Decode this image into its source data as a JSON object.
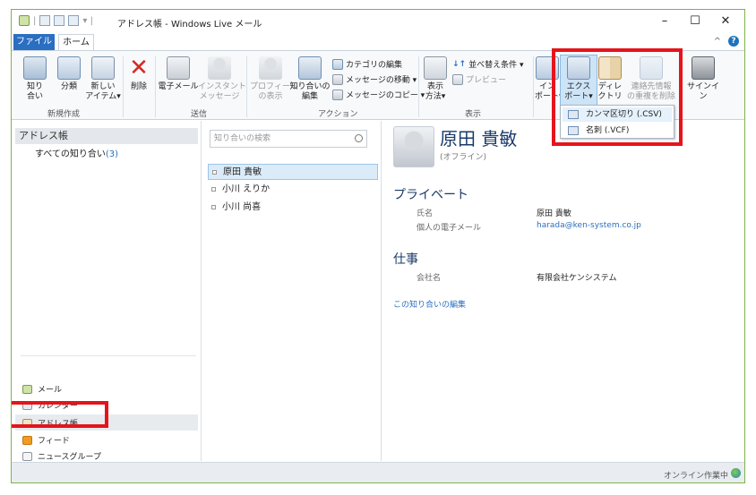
{
  "window": {
    "title": "アドレス帳 - Windows Live メール",
    "controls": {
      "minimize": "–",
      "maximize": "☐",
      "close": "✕"
    }
  },
  "tabs": {
    "file": "ファイル",
    "home": "ホーム",
    "collapse": "^",
    "help": "?"
  },
  "ribbon": {
    "new_group": {
      "label": "新規作成",
      "contact": "知り\n合い",
      "category": "分類",
      "new_item": "新しい\nアイテム▾"
    },
    "delete": "削除",
    "send_group": {
      "label": "送信",
      "email": "電子メール",
      "instant_message": "インスタント\nメッセージ"
    },
    "action_group": {
      "label": "アクション",
      "profile": "プロフィール\nの表示",
      "edit_contact": "知り合いの\n編集",
      "edit_category": "カテゴリの編集",
      "move_message": "メッセージの移動 ▾",
      "copy_message": "メッセージのコピー ▾"
    },
    "view_group": {
      "label": "表示",
      "display_method": "表示\n方法▾",
      "sort": "並べ替え条件 ▾",
      "preview": "プレビュー"
    },
    "tools": {
      "import": "イン\nポート▾",
      "export": "エクス\nポート▾",
      "directory": "ディレ\nクトリ",
      "remove_duplicates": "連絡先情報\nの重複を削除",
      "sign_in": "サインイン"
    }
  },
  "export_menu": {
    "items": [
      "カンマ区切り (.CSV)",
      "名刺 (.VCF)"
    ]
  },
  "left_pane": {
    "header": "アドレス帳",
    "all_contacts": "すべての知り合い",
    "all_contacts_count": "(3)",
    "nav": [
      "メール",
      "カレンダー",
      "アドレス帳",
      "フィード",
      "ニュースグループ"
    ]
  },
  "search": {
    "placeholder": "知り合いの検索"
  },
  "contacts": [
    "原田 貴敏",
    "小川 えりか",
    "小川 尚喜"
  ],
  "detail": {
    "name": "原田 貴敏",
    "status": "(オフライン)",
    "private_header": "プライベート",
    "name_label": "氏名",
    "name_value": "原田 貴敏",
    "email_label": "個人の電子メール",
    "email_value": "harada@ken-system.co.jp",
    "work_header": "仕事",
    "company_label": "会社名",
    "company_value": "有限会社ケンシステム",
    "edit_link": "この知り合いの編集"
  },
  "status_bar": {
    "text": "オンライン作業中"
  },
  "colors": {
    "accent": "#2b6fc1",
    "highlight_box": "#e5141c",
    "window_border": "#7fb34b"
  }
}
